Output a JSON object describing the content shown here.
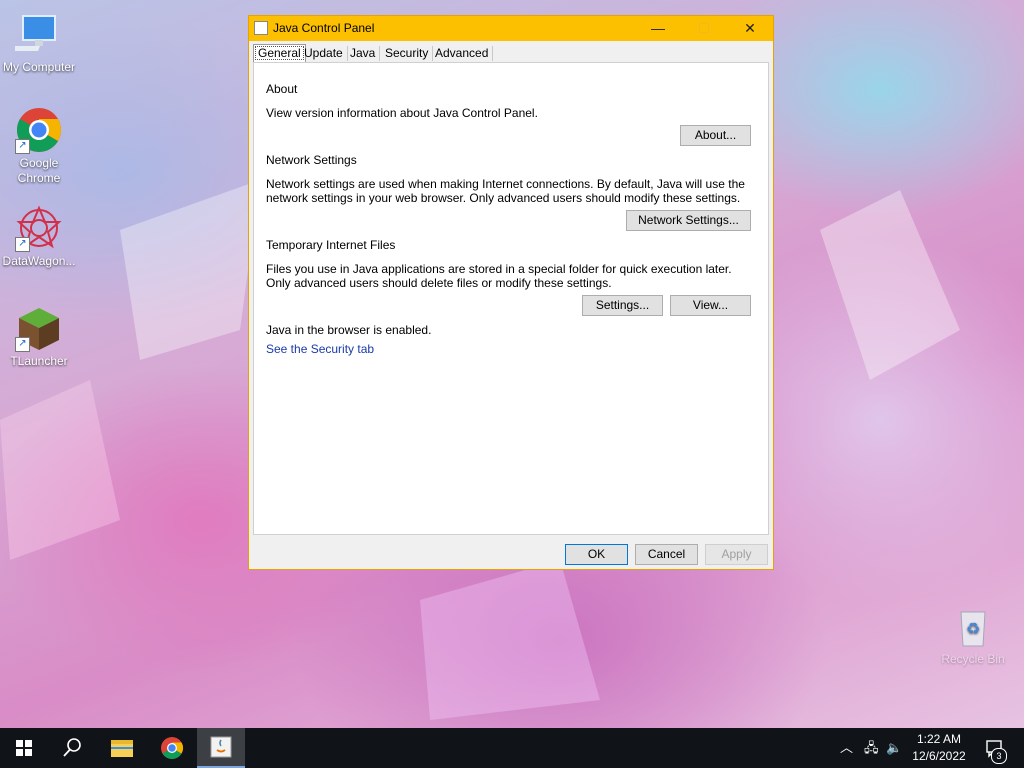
{
  "desktop": {
    "icons": [
      {
        "label": "My Computer",
        "icon": "computer-icon"
      },
      {
        "label": "Google Chrome",
        "icon": "chrome-icon"
      },
      {
        "label": "DataWagon...",
        "icon": "datawagon-icon"
      },
      {
        "label": "TLauncher",
        "icon": "tlauncher-icon"
      },
      {
        "label": "Recycle Bin",
        "icon": "recycle-bin-icon"
      }
    ]
  },
  "window": {
    "title": "Java Control Panel",
    "controls": {
      "minimize": "—",
      "maximize": "☐",
      "close": "✕"
    },
    "tabs": [
      "General",
      "Update",
      "Java",
      "Security",
      "Advanced"
    ],
    "active_tab": "General",
    "about": {
      "heading": "About",
      "text": "View version information about Java Control Panel.",
      "button": "About..."
    },
    "network": {
      "heading": "Network Settings",
      "text": "Network settings are used when making Internet connections. By default, Java will use the network settings in your web browser. Only advanced users should modify these settings.",
      "button": "Network Settings..."
    },
    "temp_files": {
      "heading": "Temporary Internet Files",
      "text": "Files you use in Java applications are stored in a special folder for quick execution later. Only advanced users should delete files or modify these settings.",
      "settings_button": "Settings...",
      "view_button": "View..."
    },
    "browser_status": "Java in the browser is enabled.",
    "security_link": "See the Security tab",
    "footer": {
      "ok": "OK",
      "cancel": "Cancel",
      "apply": "Apply"
    }
  },
  "taskbar": {
    "time": "1:22 AM",
    "date": "12/6/2022",
    "notification_count": "3"
  },
  "colors": {
    "title_bar": "#fcc000",
    "link": "#1a3aa8",
    "taskbar": "#101418"
  }
}
